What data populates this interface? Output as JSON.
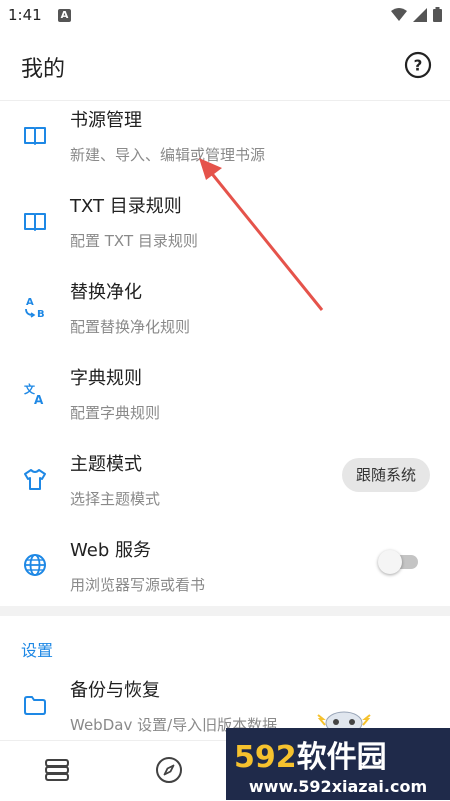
{
  "status_bar": {
    "time": "1:41",
    "a_badge": "A"
  },
  "app_bar": {
    "title": "我的",
    "help_icon": "help-circle-icon"
  },
  "items": [
    {
      "icon": "book-icon",
      "title": "书源管理",
      "subtitle": "新建、导入、编辑或管理书源"
    },
    {
      "icon": "book-icon",
      "title": "TXT 目录规则",
      "subtitle": "配置 TXT 目录规则"
    },
    {
      "icon": "replace-ab-icon",
      "title": "替换净化",
      "subtitle": "配置替换净化规则"
    },
    {
      "icon": "translate-icon",
      "title": "字典规则",
      "subtitle": "配置字典规则"
    },
    {
      "icon": "tshirt-icon",
      "title": "主题模式",
      "subtitle": "选择主题模式",
      "chip": "跟随系统"
    },
    {
      "icon": "globe-icon",
      "title": "Web 服务",
      "subtitle": "用浏览器写源或看书",
      "toggle_on": false
    }
  ],
  "section": {
    "header": "设置"
  },
  "backup": {
    "icon": "folder-icon",
    "title": "备份与恢复",
    "subtitle": "WebDav 设置/导入旧版本数据"
  },
  "bottom_nav": [
    {
      "icon": "bookshelf-icon"
    },
    {
      "icon": "compass-icon"
    }
  ],
  "watermark": {
    "brand_num": "592",
    "brand_text": "软件园",
    "url": "www.592xiazai.com"
  },
  "colors": {
    "accent": "#1e88e5",
    "arrow": "#e5534b"
  }
}
